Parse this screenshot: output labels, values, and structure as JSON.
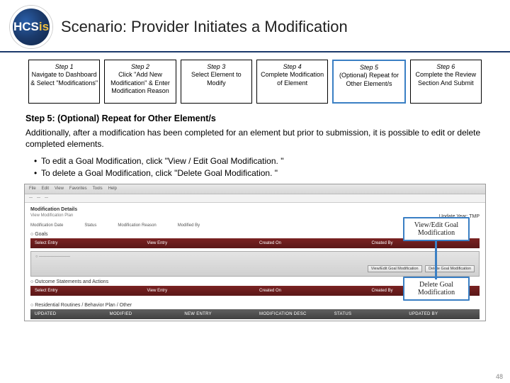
{
  "logo": {
    "letters": "HCS",
    "accent": "is"
  },
  "title": "Scenario: Provider Initiates a Modification",
  "steps": [
    {
      "title": "Step 1",
      "body": "Navigate to Dashboard & Select \"Modifications\""
    },
    {
      "title": "Step 2",
      "body": "Click \"Add New Modification\" & Enter Modification Reason"
    },
    {
      "title": "Step 3",
      "body": "Select Element to Modify"
    },
    {
      "title": "Step 4",
      "body": "Complete Modification of Element"
    },
    {
      "title": "Step 5",
      "body": "(Optional) Repeat for Other Element/s"
    },
    {
      "title": "Step 6",
      "body": "Complete the Review Section And Submit"
    }
  ],
  "sectionHead": "Step 5: (Optional) Repeat for Other Element/s",
  "para": "Additionally, after a modification has been completed for an element but prior to submission, it is possible to edit or delete completed elements.",
  "bullets": [
    "To edit a Goal Modification, click \"View / Edit Goal Modification. \"",
    "To delete a Goal Modification, click \"Delete Goal Modification. \""
  ],
  "shot": {
    "topMenu": [
      "File",
      "Edit",
      "View",
      "Favorites",
      "Tools",
      "Help"
    ],
    "modDetails": "Modification Details",
    "sublink": "View Modification Plan",
    "updateYear": "Update Year: TMP",
    "row1": [
      "Modification Date",
      "Status",
      "Modification Reason",
      "Modified By"
    ],
    "goalsHead": "Goals",
    "bar1": [
      "Select Entry",
      "View Entry",
      "Created On",
      "Created By"
    ],
    "btns": [
      "View/Edit Goal Modification",
      "Delete Goal Modification"
    ],
    "gray2Head": "Outcome Statements and Actions",
    "bar3": [
      "Select Entry",
      "View Entry",
      "Created On",
      "Created By"
    ],
    "gray3Head": "Residential Routines / Behavior Plan / Other",
    "bar4": [
      "UPDATED",
      "MODIFIED",
      "NEW ENTRY",
      "MODIFICATION DESC",
      "STATUS",
      "UPDATED BY"
    ]
  },
  "callouts": {
    "viewEdit": "View/Edit Goal Modification",
    "delete": "Delete Goal Modification"
  },
  "pagenum": "48"
}
